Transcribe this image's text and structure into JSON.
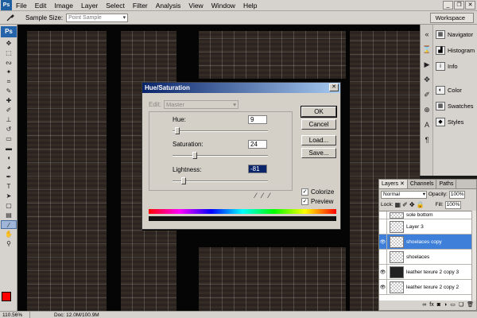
{
  "app": {
    "logo": "Ps",
    "menu": [
      "File",
      "Edit",
      "Image",
      "Layer",
      "Select",
      "Filter",
      "Analysis",
      "View",
      "Window",
      "Help"
    ]
  },
  "options_bar": {
    "sample_label": "Sample Size:",
    "sample_value": "Point Sample",
    "workspace": "Workspace"
  },
  "dock": {
    "items": [
      "Navigator",
      "Histogram",
      "Info",
      "Color",
      "Swatches",
      "Styles"
    ]
  },
  "layers": {
    "tabs": [
      "Layers",
      "Channels",
      "Paths"
    ],
    "blend_mode": "Normal",
    "opacity_label": "Opacity:",
    "opacity_value": "100%",
    "lock_label": "Lock:",
    "fill_label": "Fill:",
    "fill_value": "100%",
    "items": [
      "sole bottom",
      "Layer 3",
      "shoelaces copy",
      "shoelaces",
      "leather texure 2 copy 3",
      "leather texure 2 copy 2"
    ],
    "selected_index": 2
  },
  "dialog": {
    "title": "Hue/Saturation",
    "edit_label": "Edit:",
    "edit_value": "Master",
    "hue_label": "Hue:",
    "hue_value": "9",
    "saturation_label": "Saturation:",
    "saturation_value": "24",
    "lightness_label": "Lightness:",
    "lightness_value": "-81",
    "ok": "OK",
    "cancel": "Cancel",
    "load": "Load...",
    "save": "Save...",
    "colorize": "Colorize",
    "preview": "Preview",
    "colorize_checked": true,
    "preview_checked": true
  },
  "status": {
    "zoom": "110.56%",
    "doc": "Doc: 12.0M/100.9M"
  },
  "colors": {
    "foreground": "#ff0000",
    "background": "#ffffff",
    "selection": "#3d7fd9"
  }
}
